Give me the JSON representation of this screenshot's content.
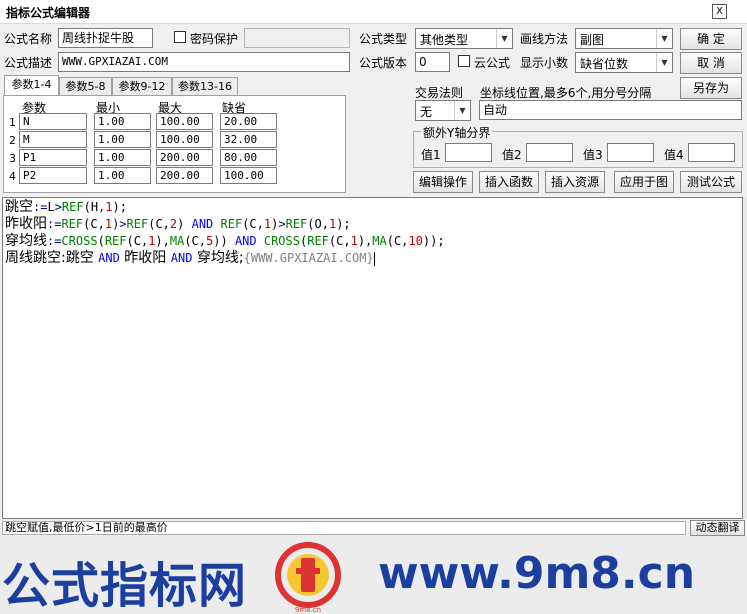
{
  "window": {
    "title": "指标公式编辑器",
    "close_label": "X"
  },
  "formula": {
    "name_label": "公式名称",
    "name_value": "周线扑捉牛股",
    "password_label": "密码保护",
    "password_value": "",
    "desc_label": "公式描述",
    "desc_value": "WWW.GPXIAZAI.COM",
    "type_label": "公式类型",
    "type_value": "其他类型",
    "draw_label": "画线方法",
    "draw_value": "副图",
    "version_label": "公式版本",
    "version_value": "0",
    "cloud_label": "云公式",
    "decimal_label": "显示小数",
    "decimal_value": "缺省位数"
  },
  "buttons": {
    "ok": "确  定",
    "cancel": "取  消",
    "save_as": "另存为",
    "edit_op": "编辑操作",
    "insert_func": "插入函数",
    "insert_res": "插入资源",
    "apply": "应用于图",
    "test": "测试公式",
    "dynamic": "动态翻译"
  },
  "tabs": [
    "参数1-4",
    "参数5-8",
    "参数9-12",
    "参数13-16"
  ],
  "params": {
    "headers": {
      "name": "参数",
      "min": "最小",
      "max": "最大",
      "default": "缺省"
    },
    "rows": [
      {
        "num": "1",
        "name": "N",
        "min": "1.00",
        "max": "100.00",
        "default": "20.00"
      },
      {
        "num": "2",
        "name": "M",
        "min": "1.00",
        "max": "100.00",
        "default": "32.00"
      },
      {
        "num": "3",
        "name": "P1",
        "min": "1.00",
        "max": "200.00",
        "default": "80.00"
      },
      {
        "num": "4",
        "name": "P2",
        "min": "1.00",
        "max": "200.00",
        "default": "100.00"
      }
    ]
  },
  "trade": {
    "rule_label": "交易法则",
    "rule_value": "无",
    "coord_label": "坐标线位置,最多6个,用分号分隔",
    "coord_value": "自动",
    "yaxis_label": "额外Y轴分界",
    "v1": "值1",
    "v2": "值2",
    "v3": "值3",
    "v4": "值4"
  },
  "status": {
    "text": "跳空赋值,最低价>1日前的最高价"
  },
  "watermark": {
    "left": "公式指标网",
    "right": "www.9m8.cn",
    "seal": "9m8.cn"
  },
  "colors": {
    "keyword": "#0000ff",
    "function": "#008000",
    "number": "#c00000",
    "banner_text": "#1b3e9f"
  }
}
